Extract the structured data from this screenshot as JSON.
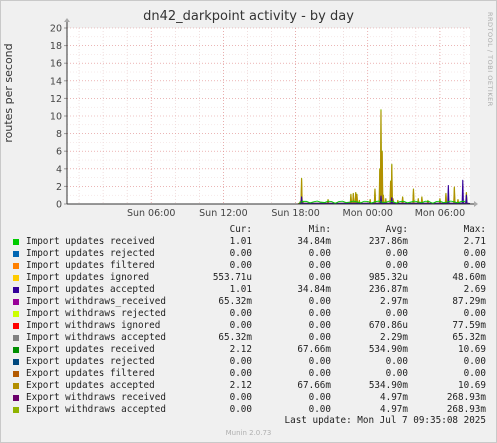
{
  "chart_data": {
    "type": "line",
    "title": "dn42_darkpoint activity - by day",
    "ylabel": "routes per second",
    "watermark": "RRDTOOL / TOBI OETIKER",
    "footer": "Munin 2.0.73",
    "ylim": [
      0,
      20
    ],
    "yticks": [
      "0",
      "2",
      "4",
      "6",
      "8",
      "10",
      "12",
      "14",
      "16",
      "18",
      "20"
    ],
    "xticks": [
      "Sun 06:00",
      "Sun 12:00",
      "Sun 18:00",
      "Mon 00:00",
      "Mon 06:00"
    ],
    "x_hours_since_sat_2300": [
      7,
      13,
      19,
      25,
      31
    ],
    "xlim_hours": [
      0,
      33.5
    ],
    "grid": true,
    "series": [
      {
        "name": "Import updates received",
        "color": "#00cc00"
      },
      {
        "name": "Import updates rejected",
        "color": "#0066b3"
      },
      {
        "name": "Import updates filtered",
        "color": "#ff8000"
      },
      {
        "name": "Import updates ignored",
        "color": "#ffcc00"
      },
      {
        "name": "Import updates accepted",
        "color": "#330099"
      },
      {
        "name": "Import withdraws_received",
        "color": "#990099"
      },
      {
        "name": "Import withdraws rejected",
        "color": "#ccff00"
      },
      {
        "name": "Import withdraws ignored",
        "color": "#ff0000"
      },
      {
        "name": "Import withdraws accepted",
        "color": "#808080"
      },
      {
        "name": "Export updates received",
        "color": "#008f00"
      },
      {
        "name": "Export updates rejected",
        "color": "#00487d"
      },
      {
        "name": "Export updates filtered",
        "color": "#b35a00"
      },
      {
        "name": "Export updates accepted",
        "color": "#b38f00"
      },
      {
        "name": "Export withdraws received",
        "color": "#6b006b"
      },
      {
        "name": "Export withdraws accepted",
        "color": "#8fb300"
      }
    ],
    "spikes": {
      "olive": [
        [
          19.4,
          0.3
        ],
        [
          19.5,
          2.9
        ],
        [
          19.6,
          0.3
        ],
        [
          21.7,
          0.5
        ],
        [
          23.6,
          1.1
        ],
        [
          23.8,
          1.2
        ],
        [
          24.0,
          1.3
        ],
        [
          24.1,
          1.1
        ],
        [
          24.3,
          0.4
        ],
        [
          25.2,
          0.5
        ],
        [
          25.6,
          1.7
        ],
        [
          26.0,
          4.0
        ],
        [
          26.1,
          10.7
        ],
        [
          26.2,
          6.0
        ],
        [
          26.3,
          1.0
        ],
        [
          26.5,
          0.6
        ],
        [
          26.9,
          2.6
        ],
        [
          27.0,
          4.5
        ],
        [
          27.1,
          0.6
        ],
        [
          27.5,
          0.4
        ],
        [
          27.9,
          0.8
        ],
        [
          28.8,
          1.7
        ],
        [
          29.2,
          0.6
        ],
        [
          29.5,
          0.8
        ],
        [
          30.0,
          0.4
        ],
        [
          31.0,
          0.6
        ],
        [
          31.5,
          1.2
        ],
        [
          32.2,
          1.9
        ],
        [
          32.5,
          0.5
        ],
        [
          33.2,
          1.3
        ]
      ],
      "navy": [
        [
          19.5,
          0.8
        ],
        [
          26.1,
          0.9
        ],
        [
          27.0,
          0.7
        ],
        [
          31.7,
          2.1
        ],
        [
          32.9,
          2.7
        ],
        [
          33.2,
          1.0
        ]
      ]
    }
  },
  "legend": {
    "headers": {
      "cur": "Cur:",
      "min": "Min:",
      "avg": "Avg:",
      "max": "Max:"
    },
    "rows": [
      {
        "name": "Import updates received",
        "cur": "1.01",
        "min": "34.84m",
        "avg": "237.86m",
        "max": "2.71"
      },
      {
        "name": "Import updates rejected",
        "cur": "0.00",
        "min": "0.00",
        "avg": "0.00",
        "max": "0.00"
      },
      {
        "name": "Import updates filtered",
        "cur": "0.00",
        "min": "0.00",
        "avg": "0.00",
        "max": "0.00"
      },
      {
        "name": "Import updates ignored",
        "cur": "553.71u",
        "min": "0.00",
        "avg": "985.32u",
        "max": "48.60m"
      },
      {
        "name": "Import updates accepted",
        "cur": "1.01",
        "min": "34.84m",
        "avg": "236.87m",
        "max": "2.69"
      },
      {
        "name": "Import withdraws_received",
        "cur": "65.32m",
        "min": "0.00",
        "avg": "2.97m",
        "max": "87.29m"
      },
      {
        "name": "Import withdraws rejected",
        "cur": "0.00",
        "min": "0.00",
        "avg": "0.00",
        "max": "0.00"
      },
      {
        "name": "Import withdraws ignored",
        "cur": "0.00",
        "min": "0.00",
        "avg": "670.86u",
        "max": "77.59m"
      },
      {
        "name": "Import withdraws accepted",
        "cur": "65.32m",
        "min": "0.00",
        "avg": "2.29m",
        "max": "65.32m"
      },
      {
        "name": "Export updates received",
        "cur": "2.12",
        "min": "67.66m",
        "avg": "534.90m",
        "max": "10.69"
      },
      {
        "name": "Export updates rejected",
        "cur": "0.00",
        "min": "0.00",
        "avg": "0.00",
        "max": "0.00"
      },
      {
        "name": "Export updates filtered",
        "cur": "0.00",
        "min": "0.00",
        "avg": "0.00",
        "max": "0.00"
      },
      {
        "name": "Export updates accepted",
        "cur": "2.12",
        "min": "67.66m",
        "avg": "534.90m",
        "max": "10.69"
      },
      {
        "name": "Export withdraws received",
        "cur": "0.00",
        "min": "0.00",
        "avg": "4.97m",
        "max": "268.93m"
      },
      {
        "name": "Export withdraws accepted",
        "cur": "0.00",
        "min": "0.00",
        "avg": "4.97m",
        "max": "268.93m"
      }
    ],
    "last_update": "Last update: Mon Jul  7 09:35:08 2025"
  }
}
